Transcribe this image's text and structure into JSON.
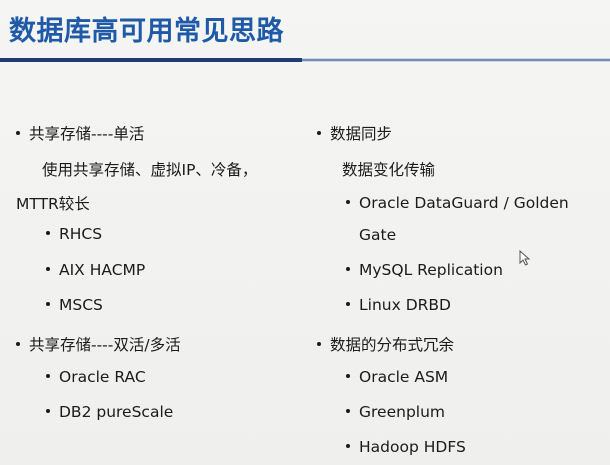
{
  "slide": {
    "title": "数据库高可用常见思路",
    "left": {
      "item1": "共享存储----单活",
      "item1_desc_a": "使用共享存储、虚拟IP、冷备，",
      "item1_desc_b": "MTTR较长",
      "item1_subs": [
        "RHCS",
        "AIX HACMP",
        "MSCS"
      ],
      "item2": "共享存储----双活/多活",
      "item2_subs": [
        "Oracle RAC",
        "DB2 pureScale"
      ]
    },
    "right": {
      "item1": "数据同步",
      "item1_desc": "数据变化传输",
      "item1_subs_a": "Oracle DataGuard / Golden",
      "item1_subs_a_cont": "Gate",
      "item1_subs": [
        "MySQL Replication",
        "Linux DRBD"
      ],
      "item2": "数据的分布式冗余",
      "item2_subs": [
        "Oracle ASM",
        "Greenplum",
        "Hadoop HDFS"
      ]
    }
  },
  "icons": {
    "cursor": "mouse-pointer-icon"
  },
  "colors": {
    "title": "#1f5aa8",
    "rule_accent": "#1f3d74",
    "rule_light": "#c9d4e4",
    "background": "#f2f2f0",
    "text": "#1b1b1b"
  }
}
